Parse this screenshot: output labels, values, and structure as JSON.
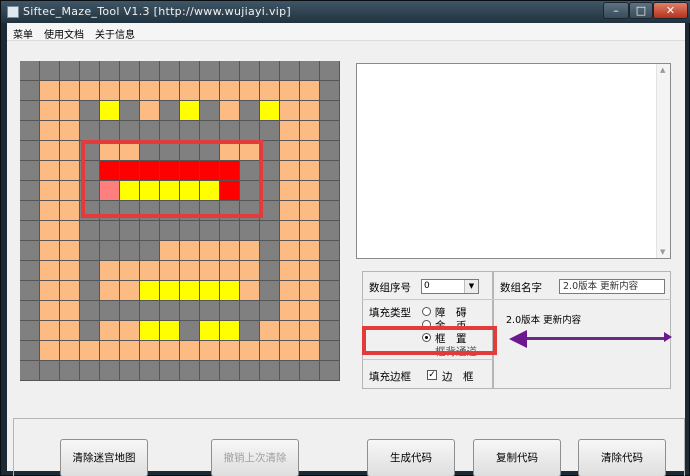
{
  "window": {
    "title": "Siftec_Maze_Tool   V1.3    [http://www.wujiayi.vip]"
  },
  "menu": [
    "菜单",
    "使用文档",
    "关于信息"
  ],
  "maze": {
    "rows": [
      "0000000000000000",
      "0111111111111110",
      "0110201020102110",
      "0110000000000110",
      "0110110000110110",
      "0110333333300110",
      "0110422222300110",
      "0110000000000110",
      "0110000000000110",
      "0110000111110110",
      "0110111111110110",
      "0110112222210110",
      "0110000000000110",
      "0110112202201110",
      "0111111111111110",
      "0000000000000000"
    ],
    "colors": {
      "0": "#808080",
      "1": "#fdbb84",
      "2": "#ffff00",
      "3": "#ff0000",
      "4": "#ff7f7f"
    }
  },
  "annotation_color": "#e23b3b",
  "arrow_color": "#6a1a8c",
  "array_index": {
    "label": "数组序号",
    "value": "0"
  },
  "fill_type": {
    "label": "填充类型",
    "options": [
      "障　碍",
      "金　币",
      "框　置",
      "框背通道"
    ],
    "selected_index": 2
  },
  "fill_border": {
    "label": "填充边框",
    "checkbox_label": "边　框",
    "checked": true
  },
  "array_name": {
    "label": "数组名字",
    "value": "2.0版本 更新内容"
  },
  "preview_text": "2.0版本 更新内容",
  "buttons": {
    "clear_maze": "清除迷宫地图",
    "undo_clear": "撤销上次清除",
    "generate": "生成代码",
    "copy": "复制代码",
    "clear_code": "清除代码"
  }
}
